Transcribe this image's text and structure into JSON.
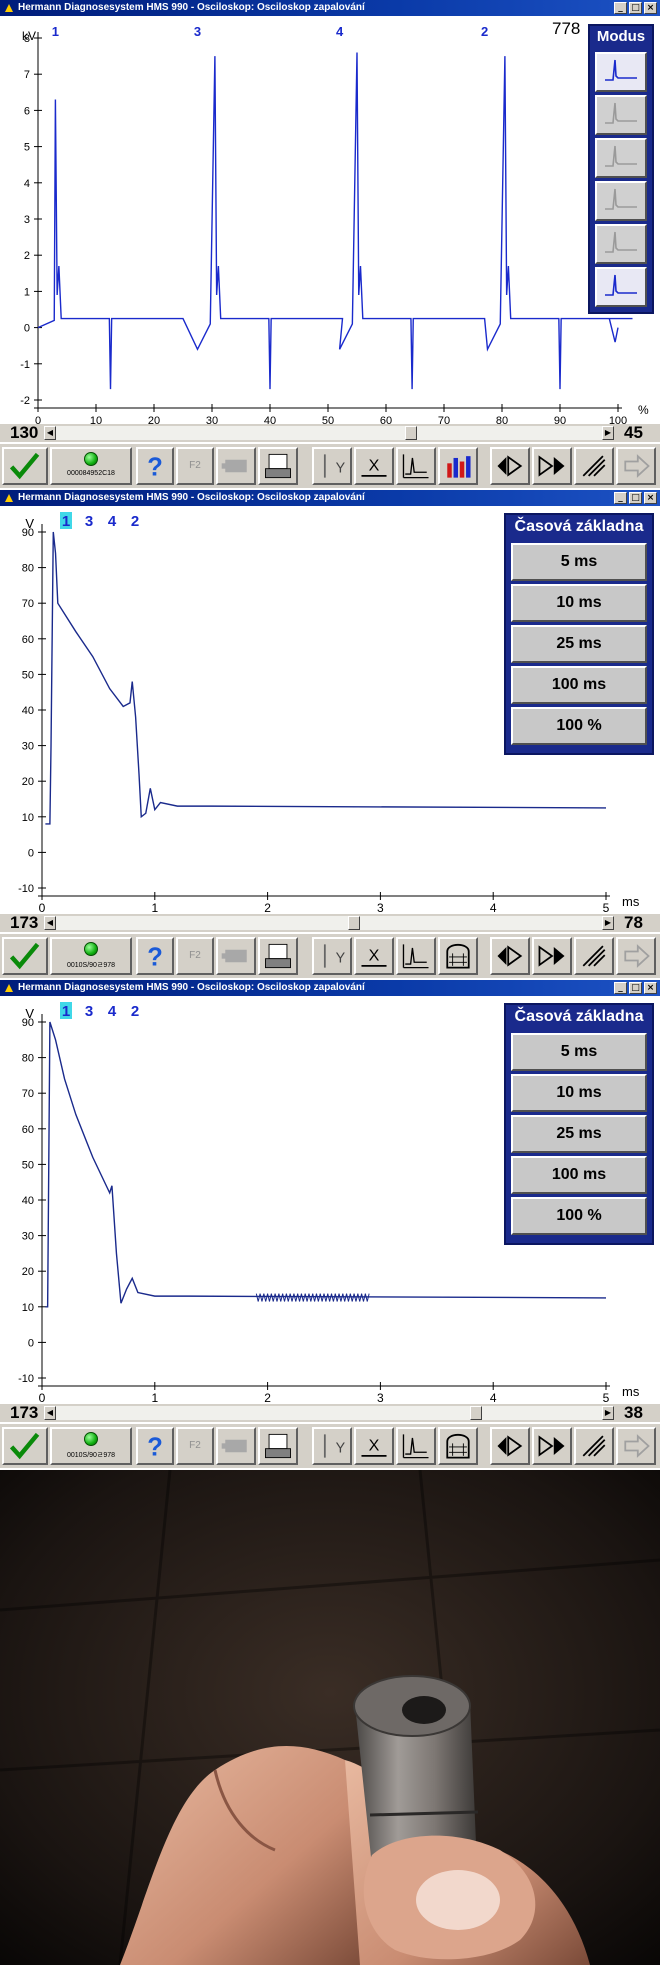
{
  "panel1": {
    "title": "Hermann Diagnosesystem HMS 990 - Osciloskop: Osciloskop zapalování",
    "corner_value": "778",
    "y_unit": "kV",
    "x_unit": "%",
    "y_ticks": [
      "8",
      "7",
      "6",
      "5",
      "4",
      "3",
      "2",
      "1",
      "0",
      "-1",
      "-2"
    ],
    "x_ticks": [
      "0",
      "10",
      "20",
      "30",
      "40",
      "50",
      "60",
      "70",
      "80",
      "90",
      "100"
    ],
    "cylinder_labels": [
      "1",
      "3",
      "4",
      "2"
    ],
    "side_title": "Modus",
    "side_icons": [
      "mode-active-icon",
      "mode-icon",
      "mode-icon",
      "mode-icon",
      "mode-icon",
      "mode-alt-icon"
    ],
    "scroll_left": "130",
    "scroll_right": "45",
    "status_code": "000084952C18",
    "trace_color": "#1a2acc"
  },
  "panel2": {
    "title": "Hermann Diagnosesystem HMS 990 - Osciloskop: Osciloskop zapalování",
    "y_unit": "V",
    "x_unit": "ms",
    "channel_labels": [
      "1",
      "3",
      "4",
      "2"
    ],
    "selected_channel": "1",
    "y_ticks": [
      "90",
      "80",
      "70",
      "60",
      "50",
      "40",
      "30",
      "20",
      "10",
      "0",
      "-10"
    ],
    "x_ticks": [
      "0",
      "1",
      "2",
      "3",
      "4",
      "5"
    ],
    "side_title": "Časová základna",
    "side_buttons": [
      "5 ms",
      "10 ms",
      "25 ms",
      "100 ms",
      "100 %"
    ],
    "scroll_left": "173",
    "scroll_right": "78",
    "status_code": "0010S/90ㄹ978"
  },
  "panel3": {
    "title": "Hermann Diagnosesystem HMS 990 - Osciloskop: Osciloskop zapalování",
    "y_unit": "V",
    "x_unit": "ms",
    "channel_labels": [
      "1",
      "3",
      "4",
      "2"
    ],
    "selected_channel": "1",
    "y_ticks": [
      "90",
      "80",
      "70",
      "60",
      "50",
      "40",
      "30",
      "20",
      "10",
      "0",
      "-10"
    ],
    "x_ticks": [
      "0",
      "1",
      "2",
      "3",
      "4",
      "5"
    ],
    "side_title": "Časová základna",
    "side_buttons": [
      "5 ms",
      "10 ms",
      "25 ms",
      "100 ms",
      "100 %"
    ],
    "scroll_left": "173",
    "scroll_right": "38",
    "status_code": "0010S/90ㄹ978"
  },
  "toolbar": {
    "f2_label": "F2",
    "icons": [
      "checkmark-icon",
      "status-led-icon",
      "help-icon",
      "f2-icon",
      "sensor-icon",
      "print-icon",
      "y-cursor-icon",
      "x-cursor-icon",
      "waveform-icon",
      "bar-chart-icon",
      "nav-left-icon",
      "nav-right-icon",
      "marker-icon",
      "arrow-right-icon"
    ]
  },
  "photo": {
    "description_icon": "photo-hand-holding-spark-plug-icon"
  }
}
